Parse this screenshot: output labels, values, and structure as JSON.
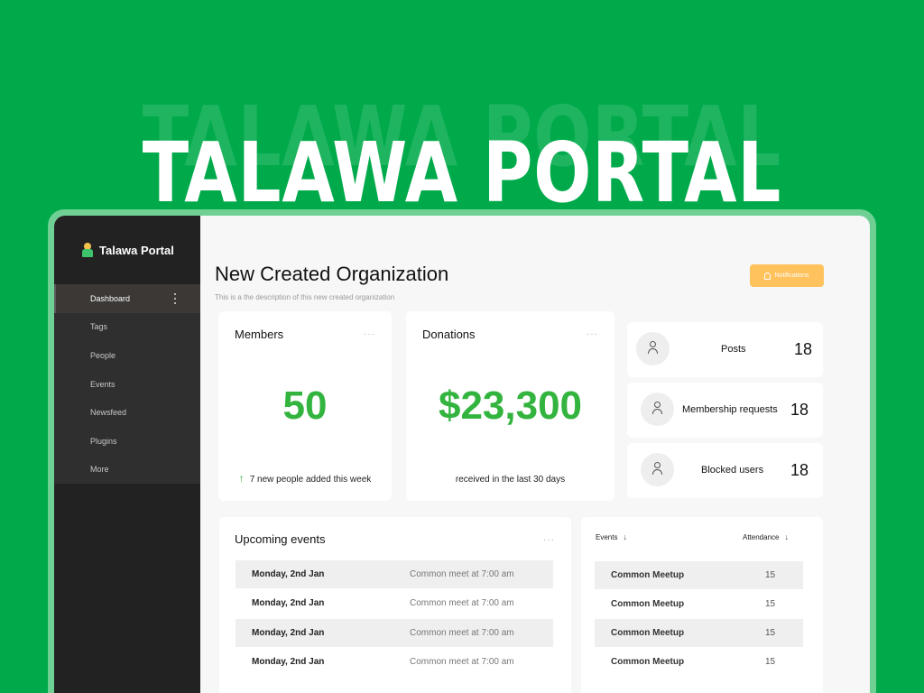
{
  "hero": {
    "title": "TALAWA PORTAL"
  },
  "sidebar": {
    "brand": "Talawa Portal",
    "items": [
      {
        "label": "Dashboard",
        "active": true
      },
      {
        "label": "Tags"
      },
      {
        "label": "People"
      },
      {
        "label": "Events"
      },
      {
        "label": "Newsfeed"
      },
      {
        "label": "Plugins"
      },
      {
        "label": "More"
      }
    ]
  },
  "header": {
    "title": "New Created Organization",
    "description": "This is a the description of this new created organization",
    "notifications_label": "Notifications"
  },
  "members_card": {
    "title": "Members",
    "value": "50",
    "footer": "7 new people added this week"
  },
  "donations_card": {
    "title": "Donations",
    "value": "$23,300",
    "footer": "received  in the last 30 days"
  },
  "stats": [
    {
      "label": "Posts",
      "value": "18"
    },
    {
      "label": "Membership requests",
      "value": "18"
    },
    {
      "label": "Blocked users",
      "value": "18"
    }
  ],
  "upcoming": {
    "title": "Upcoming events",
    "rows": [
      {
        "date": "Monday, 2nd Jan",
        "text": "Common meet at 7:00 am"
      },
      {
        "date": "Monday, 2nd Jan",
        "text": "Common meet at 7:00 am"
      },
      {
        "date": "Monday, 2nd Jan",
        "text": "Common meet at 7:00 am"
      },
      {
        "date": "Monday, 2nd Jan",
        "text": "Common meet at 7:00 am"
      }
    ]
  },
  "attendance": {
    "col_events": "Events",
    "col_attendance": "Attendance",
    "rows": [
      {
        "name": "Common Meetup",
        "value": "15"
      },
      {
        "name": "Common Meetup",
        "value": "15"
      },
      {
        "name": "Common Meetup",
        "value": "15"
      },
      {
        "name": "Common Meetup",
        "value": "15"
      }
    ]
  },
  "colors": {
    "background": "#00aa4b",
    "accent_green": "#33b43f",
    "notification": "#ffc25c",
    "sidebar": "#222222"
  }
}
